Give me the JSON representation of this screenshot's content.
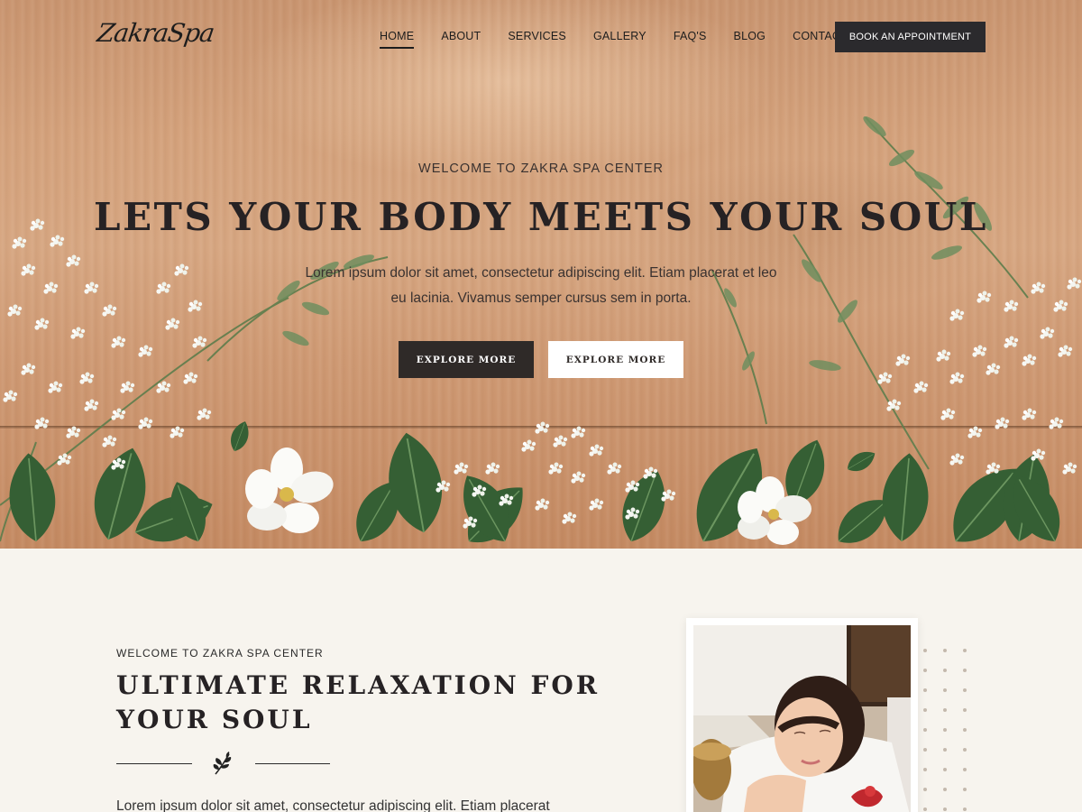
{
  "header": {
    "logo": "ZakraSpa",
    "nav": [
      "HOME",
      "ABOUT",
      "SERVICES",
      "GALLERY",
      "FAQ'S",
      "BLOG",
      "CONTACT"
    ],
    "active_nav": "HOME",
    "cta": "BOOK AN APPOINTMENT"
  },
  "hero": {
    "subtitle": "WELCOME TO ZAKRA SPA CENTER",
    "title": "LETS YOUR BODY MEETS YOUR SOUL",
    "description": "Lorem ipsum dolor sit amet, consectetur adipiscing elit. Etiam placerat et leo eu lacinia. Vivamus semper cursus sem in porta.",
    "buttons": [
      "EXPLORE MORE",
      "EXPLORE MORE"
    ]
  },
  "about": {
    "subtitle": "WELCOME TO ZAKRA SPA CENTER",
    "title": "ULTIMATE RELAXATION FOR YOUR SOUL",
    "text": "Lorem ipsum dolor sit amet, consectetur adipiscing elit. Etiam placerat"
  },
  "colors": {
    "dark": "#2b2a2d",
    "background": "#f7f4ee",
    "wood": "#d4a27c",
    "leaf": "#3f6a3a"
  },
  "icons": {
    "divider": "leaf-sprig-icon"
  }
}
